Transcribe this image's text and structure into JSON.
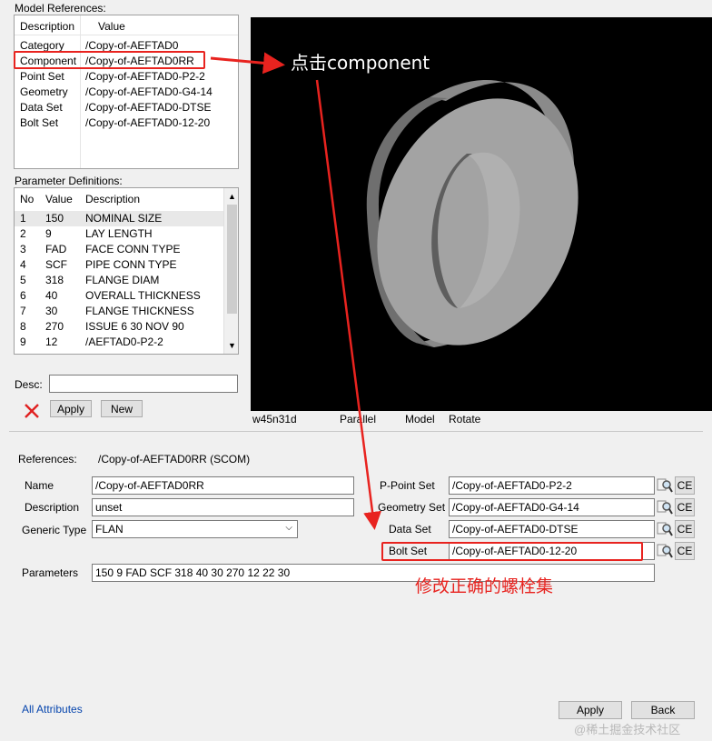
{
  "model_refs": {
    "title": "Model References:",
    "headers": [
      "Description",
      "Value"
    ],
    "rows": [
      {
        "desc": "Category",
        "value": "/Copy-of-AEFTAD0"
      },
      {
        "desc": "Component",
        "value": "/Copy-of-AEFTAD0RR"
      },
      {
        "desc": "Point Set",
        "value": "/Copy-of-AEFTAD0-P2-2"
      },
      {
        "desc": "Geometry",
        "value": "/Copy-of-AEFTAD0-G4-14"
      },
      {
        "desc": "Data Set",
        "value": "/Copy-of-AEFTAD0-DTSE"
      },
      {
        "desc": "Bolt Set",
        "value": "/Copy-of-AEFTAD0-12-20"
      }
    ]
  },
  "param_defs": {
    "title": "Parameter Definitions:",
    "headers": [
      "No",
      "Value",
      "Description"
    ],
    "rows": [
      {
        "no": "1",
        "value": "150",
        "desc": "NOMINAL SIZE"
      },
      {
        "no": "2",
        "value": "9",
        "desc": "LAY LENGTH"
      },
      {
        "no": "3",
        "value": "FAD",
        "desc": "FACE CONN TYPE"
      },
      {
        "no": "4",
        "value": "SCF",
        "desc": "PIPE CONN TYPE"
      },
      {
        "no": "5",
        "value": "318",
        "desc": "FLANGE DIAM"
      },
      {
        "no": "6",
        "value": "40",
        "desc": "OVERALL THICKNESS"
      },
      {
        "no": "7",
        "value": "30",
        "desc": "FLANGE THICKNESS"
      },
      {
        "no": "8",
        "value": "270",
        "desc": "ISSUE 6  30 NOV 90"
      },
      {
        "no": "9",
        "value": "12",
        "desc": "/AEFTAD0-P2-2"
      }
    ]
  },
  "desc_label": "Desc:",
  "desc_value": "",
  "apply_small": "Apply",
  "new_btn": "New",
  "viewer": {
    "status": [
      "w45n31d",
      "Parallel",
      "Model",
      "Rotate"
    ]
  },
  "annotations": {
    "click_component": "点击component",
    "fix_bolt": "修改正确的螺栓集"
  },
  "form": {
    "references_label": "References:",
    "references_value": "/Copy-of-AEFTAD0RR (SCOM)",
    "name_label": "Name",
    "name_value": "/Copy-of-AEFTAD0RR",
    "description_label": "Description",
    "description_value": "unset",
    "generic_type_label": "Generic Type",
    "generic_type_value": "FLAN",
    "ppoint_label": "P-Point Set",
    "ppoint_value": "/Copy-of-AEFTAD0-P2-2",
    "geometry_label": "Geometry Set",
    "geometry_value": "/Copy-of-AEFTAD0-G4-14",
    "dataset_label": "Data Set",
    "dataset_value": "/Copy-of-AEFTAD0-DTSE",
    "boltset_label": "Bolt Set",
    "boltset_value": "/Copy-of-AEFTAD0-12-20",
    "ce_label": "CE",
    "parameters_label": "Parameters",
    "parameters_value": "150 9 FAD SCF 318 40 30 270 12 22 30"
  },
  "footer": {
    "all_attributes": "All Attributes",
    "apply": "Apply",
    "back": "Back",
    "watermark": "@稀土掘金技术社区"
  },
  "colors": {
    "annotation_red": "#e8231f",
    "link_blue": "#0645ad",
    "viewer_bg": "#000000",
    "flange_gray": "#9a9a9a"
  }
}
